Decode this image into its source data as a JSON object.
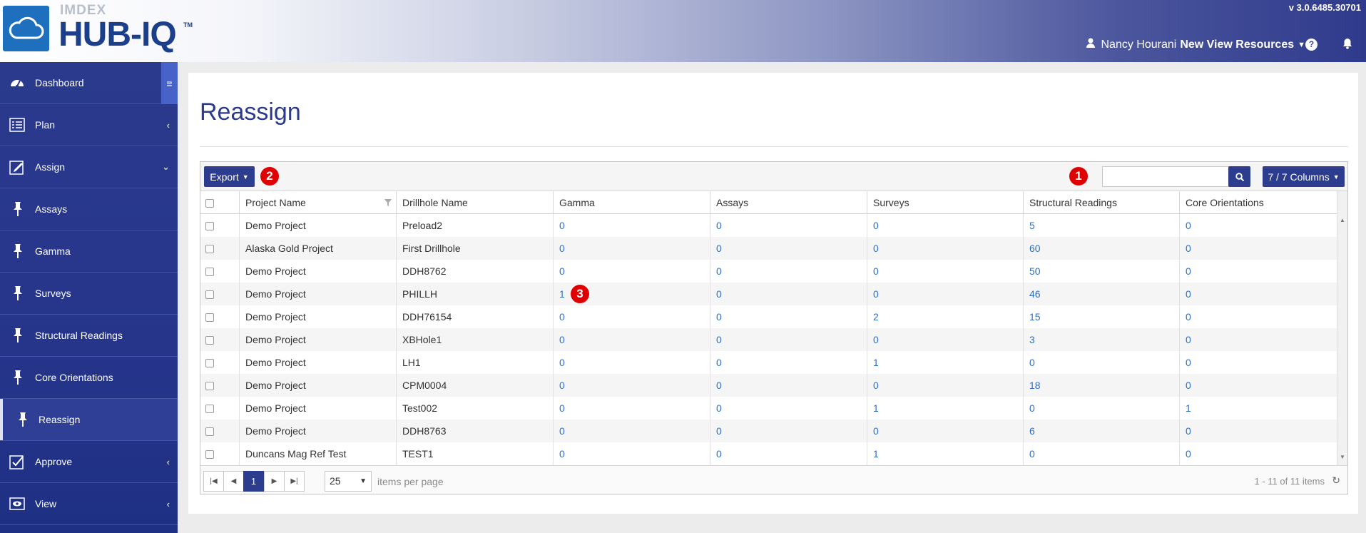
{
  "header": {
    "brand_top": "IMDEX",
    "brand_main": "HUB-IQ",
    "brand_tm": "TM",
    "version": "v 3.0.6485.30701",
    "user_name": "Nancy Hourani",
    "org_name": "New View Resources",
    "help_label": "?"
  },
  "sidebar": {
    "items": [
      {
        "label": "Dashboard",
        "icon": "dashboard-icon"
      },
      {
        "label": "Plan",
        "icon": "list-icon"
      },
      {
        "label": "Assign",
        "icon": "edit-icon"
      },
      {
        "label": "Assays",
        "icon": "pin-icon"
      },
      {
        "label": "Gamma",
        "icon": "pin-icon"
      },
      {
        "label": "Surveys",
        "icon": "pin-icon"
      },
      {
        "label": "Structural Readings",
        "icon": "pin-icon"
      },
      {
        "label": "Core Orientations",
        "icon": "pin-icon"
      },
      {
        "label": "Reassign",
        "icon": "pin-icon"
      },
      {
        "label": "Approve",
        "icon": "checkbox-icon"
      },
      {
        "label": "View",
        "icon": "eye-icon"
      }
    ]
  },
  "page": {
    "title": "Reassign"
  },
  "toolbar": {
    "export_label": "Export",
    "search_value": "",
    "columns_label": "7 / 7 Columns"
  },
  "annotations": [
    "1",
    "2",
    "3"
  ],
  "table": {
    "columns": [
      "Project Name",
      "Drillhole Name",
      "Gamma",
      "Assays",
      "Surveys",
      "Structural Readings",
      "Core Orientations"
    ],
    "rows": [
      [
        "Demo Project",
        "Preload2",
        "0",
        "0",
        "0",
        "5",
        "0"
      ],
      [
        "Alaska Gold Project",
        "First Drillhole",
        "0",
        "0",
        "0",
        "60",
        "0"
      ],
      [
        "Demo Project",
        "DDH8762",
        "0",
        "0",
        "0",
        "50",
        "0"
      ],
      [
        "Demo Project",
        "PHILLH",
        "1",
        "0",
        "0",
        "46",
        "0"
      ],
      [
        "Demo Project",
        "DDH76154",
        "0",
        "0",
        "2",
        "15",
        "0"
      ],
      [
        "Demo Project",
        "XBHole1",
        "0",
        "0",
        "0",
        "3",
        "0"
      ],
      [
        "Demo Project",
        "LH1",
        "0",
        "0",
        "1",
        "0",
        "0"
      ],
      [
        "Demo Project",
        "CPM0004",
        "0",
        "0",
        "0",
        "18",
        "0"
      ],
      [
        "Demo Project",
        "Test002",
        "0",
        "0",
        "1",
        "0",
        "1"
      ],
      [
        "Demo Project",
        "DDH8763",
        "0",
        "0",
        "0",
        "6",
        "0"
      ],
      [
        "Duncans Mag Ref Test",
        "TEST1",
        "0",
        "0",
        "1",
        "0",
        "0"
      ]
    ]
  },
  "pager": {
    "current_page": "1",
    "page_size": "25",
    "items_per_page_label": "items per page",
    "range_text": "1 - 11 of 11 items"
  }
}
